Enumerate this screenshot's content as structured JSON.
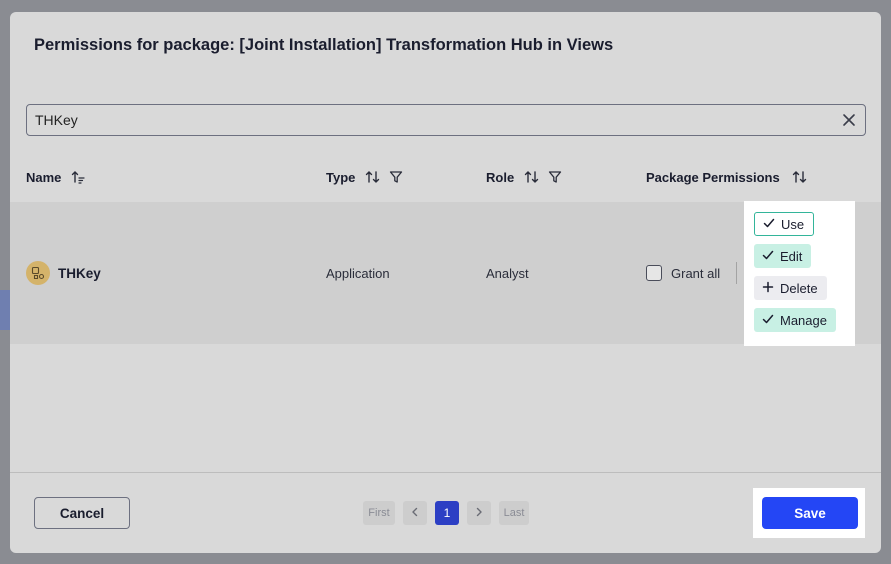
{
  "modal": {
    "title": "Permissions for package: [Joint Installation] Transformation Hub in Views"
  },
  "search": {
    "value": "THKey",
    "clear_icon": "close-icon"
  },
  "table": {
    "columns": {
      "name": "Name",
      "type": "Type",
      "role": "Role",
      "permissions": "Package Permissions"
    },
    "rows": [
      {
        "name": "THKey",
        "type": "Application",
        "role": "Analyst",
        "grant_all_label": "Grant all",
        "grant_all_checked": false,
        "permissions": [
          {
            "label": "Use",
            "state": "granted",
            "icon": "check-icon"
          },
          {
            "label": "Edit",
            "state": "granted",
            "icon": "check-icon"
          },
          {
            "label": "Delete",
            "state": "not-granted",
            "icon": "plus-icon"
          },
          {
            "label": "Manage",
            "state": "granted",
            "icon": "check-icon"
          }
        ]
      }
    ]
  },
  "footer": {
    "cancel_label": "Cancel",
    "save_label": "Save",
    "pagination": {
      "first": "First",
      "last": "Last",
      "current_page": "1"
    }
  },
  "colors": {
    "accent": "#2446f5",
    "page_active": "#2c3fc4",
    "granted": "#c8f0e4",
    "granted_border": "#33b59a",
    "app_icon": "#d4b36a"
  }
}
